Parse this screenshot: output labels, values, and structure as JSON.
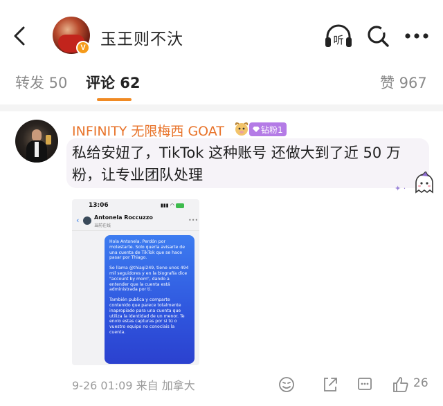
{
  "header": {
    "title": "玉王则不汏",
    "verified_badge": "V",
    "icons": [
      "back-arrow-icon",
      "listen-headphones-icon",
      "search-icon",
      "more-dots-icon"
    ],
    "listen_label": "听"
  },
  "tabs": [
    {
      "label": "转发 50",
      "active": false
    },
    {
      "label": "评论 62",
      "active": true
    },
    {
      "label": "赞 967",
      "active": false
    }
  ],
  "accent_color": "#f08a24",
  "comment": {
    "author": "INFINITY 无限梅西 GOAT",
    "fan_badge": "钻粉1",
    "text": "私给安妞了，TikTok 这种账号 还做大到了近 50 万粉，让专业团队处理",
    "screenshot": {
      "time": "13:06",
      "contact_name": "Antonela Roccuzzo",
      "contact_status": "当前在线",
      "message": [
        "Hola Antonela. Perdón por molestarte. Solo quería avisarte de una cuenta de TikTok que se hace pasar por Thiago.",
        "Se llama @thiagi249, tiene unos 494 mil seguidores y en la biografía dice \"account by mom\", dando a entender que la cuenta está administrada por ti.",
        "También publica y comparte contenido que parece totalmente inapropiado para una cuenta que utiliza la identidad de un menor. Te envío estas capturas por si tú o vuestro equipo no conocíais la cuenta."
      ]
    },
    "timestamp": "9-26 01:09",
    "source": "来自 加拿大",
    "like_count": "26",
    "footer_icons": [
      "emoji-icon",
      "share-icon",
      "comment-icon",
      "like-icon"
    ]
  }
}
